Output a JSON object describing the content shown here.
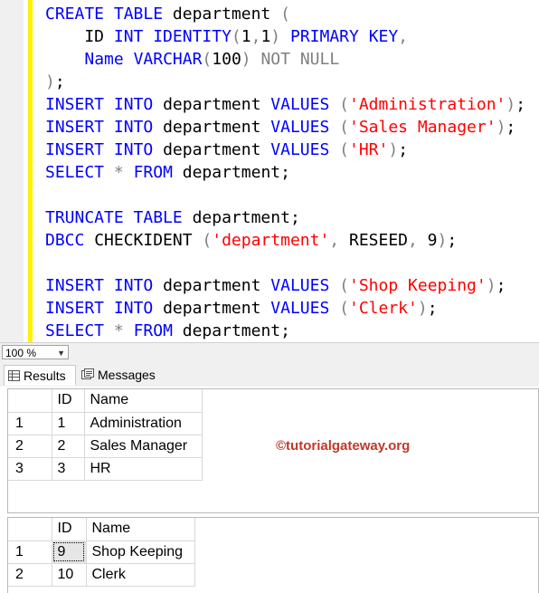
{
  "editor": {
    "lines": [
      [
        {
          "t": "CREATE",
          "c": "kw"
        },
        {
          "t": " ",
          "c": "id"
        },
        {
          "t": "TABLE",
          "c": "kw"
        },
        {
          "t": " department ",
          "c": "id"
        },
        {
          "t": "(",
          "c": "op"
        }
      ],
      [
        {
          "t": "    ID ",
          "c": "id"
        },
        {
          "t": "INT",
          "c": "kw"
        },
        {
          "t": " ",
          "c": "id"
        },
        {
          "t": "IDENTITY",
          "c": "kw"
        },
        {
          "t": "(",
          "c": "op"
        },
        {
          "t": "1",
          "c": "id"
        },
        {
          "t": ",",
          "c": "op"
        },
        {
          "t": "1",
          "c": "id"
        },
        {
          "t": ")",
          "c": "op"
        },
        {
          "t": " ",
          "c": "id"
        },
        {
          "t": "PRIMARY",
          "c": "kw"
        },
        {
          "t": " ",
          "c": "id"
        },
        {
          "t": "KEY",
          "c": "kw"
        },
        {
          "t": ",",
          "c": "op"
        }
      ],
      [
        {
          "t": "    ",
          "c": "id"
        },
        {
          "t": "Name",
          "c": "kw"
        },
        {
          "t": " ",
          "c": "id"
        },
        {
          "t": "VARCHAR",
          "c": "kw"
        },
        {
          "t": "(",
          "c": "op"
        },
        {
          "t": "100",
          "c": "id"
        },
        {
          "t": ")",
          "c": "op"
        },
        {
          "t": " ",
          "c": "id"
        },
        {
          "t": "NOT",
          "c": "op"
        },
        {
          "t": " ",
          "c": "id"
        },
        {
          "t": "NULL",
          "c": "op"
        }
      ],
      [
        {
          "t": ")",
          "c": "op"
        },
        {
          "t": ";",
          "c": "id"
        }
      ],
      [
        {
          "t": "INSERT",
          "c": "kw"
        },
        {
          "t": " ",
          "c": "id"
        },
        {
          "t": "INTO",
          "c": "kw"
        },
        {
          "t": " department ",
          "c": "id"
        },
        {
          "t": "VALUES",
          "c": "kw"
        },
        {
          "t": " ",
          "c": "id"
        },
        {
          "t": "(",
          "c": "op"
        },
        {
          "t": "'Administration'",
          "c": "str"
        },
        {
          "t": ")",
          "c": "op"
        },
        {
          "t": ";",
          "c": "id"
        }
      ],
      [
        {
          "t": "INSERT",
          "c": "kw"
        },
        {
          "t": " ",
          "c": "id"
        },
        {
          "t": "INTO",
          "c": "kw"
        },
        {
          "t": " department ",
          "c": "id"
        },
        {
          "t": "VALUES",
          "c": "kw"
        },
        {
          "t": " ",
          "c": "id"
        },
        {
          "t": "(",
          "c": "op"
        },
        {
          "t": "'Sales Manager'",
          "c": "str"
        },
        {
          "t": ")",
          "c": "op"
        },
        {
          "t": ";",
          "c": "id"
        }
      ],
      [
        {
          "t": "INSERT",
          "c": "kw"
        },
        {
          "t": " ",
          "c": "id"
        },
        {
          "t": "INTO",
          "c": "kw"
        },
        {
          "t": " department ",
          "c": "id"
        },
        {
          "t": "VALUES",
          "c": "kw"
        },
        {
          "t": " ",
          "c": "id"
        },
        {
          "t": "(",
          "c": "op"
        },
        {
          "t": "'HR'",
          "c": "str"
        },
        {
          "t": ")",
          "c": "op"
        },
        {
          "t": ";",
          "c": "id"
        }
      ],
      [
        {
          "t": "SELECT",
          "c": "kw"
        },
        {
          "t": " ",
          "c": "id"
        },
        {
          "t": "*",
          "c": "op"
        },
        {
          "t": " ",
          "c": "id"
        },
        {
          "t": "FROM",
          "c": "kw"
        },
        {
          "t": " department;",
          "c": "id"
        }
      ],
      [
        {
          "t": "",
          "c": "id"
        }
      ],
      [
        {
          "t": "TRUNCATE",
          "c": "kw"
        },
        {
          "t": " ",
          "c": "id"
        },
        {
          "t": "TABLE",
          "c": "kw"
        },
        {
          "t": " department;",
          "c": "id"
        }
      ],
      [
        {
          "t": "DBCC",
          "c": "kw"
        },
        {
          "t": " CHECKIDENT ",
          "c": "id"
        },
        {
          "t": "(",
          "c": "op"
        },
        {
          "t": "'department'",
          "c": "str"
        },
        {
          "t": ",",
          "c": "op"
        },
        {
          "t": " RESEED",
          "c": "id"
        },
        {
          "t": ",",
          "c": "op"
        },
        {
          "t": " 9",
          "c": "id"
        },
        {
          "t": ")",
          "c": "op"
        },
        {
          "t": ";",
          "c": "id"
        }
      ],
      [
        {
          "t": "",
          "c": "id"
        }
      ],
      [
        {
          "t": "INSERT",
          "c": "kw"
        },
        {
          "t": " ",
          "c": "id"
        },
        {
          "t": "INTO",
          "c": "kw"
        },
        {
          "t": " department ",
          "c": "id"
        },
        {
          "t": "VALUES",
          "c": "kw"
        },
        {
          "t": " ",
          "c": "id"
        },
        {
          "t": "(",
          "c": "op"
        },
        {
          "t": "'Shop Keeping'",
          "c": "str"
        },
        {
          "t": ")",
          "c": "op"
        },
        {
          "t": ";",
          "c": "id"
        }
      ],
      [
        {
          "t": "INSERT",
          "c": "kw"
        },
        {
          "t": " ",
          "c": "id"
        },
        {
          "t": "INTO",
          "c": "kw"
        },
        {
          "t": " department ",
          "c": "id"
        },
        {
          "t": "VALUES",
          "c": "kw"
        },
        {
          "t": " ",
          "c": "id"
        },
        {
          "t": "(",
          "c": "op"
        },
        {
          "t": "'Clerk'",
          "c": "str"
        },
        {
          "t": ")",
          "c": "op"
        },
        {
          "t": ";",
          "c": "id"
        }
      ],
      [
        {
          "t": "SELECT",
          "c": "kw"
        },
        {
          "t": " ",
          "c": "id"
        },
        {
          "t": "*",
          "c": "op"
        },
        {
          "t": " ",
          "c": "id"
        },
        {
          "t": "FROM",
          "c": "kw"
        },
        {
          "t": " department;",
          "c": "id"
        }
      ]
    ]
  },
  "zoom": {
    "value": "100 %"
  },
  "tabs": {
    "results_label": "Results",
    "messages_label": "Messages"
  },
  "result1": {
    "columns": [
      "ID",
      "Name"
    ],
    "rows": [
      {
        "num": "1",
        "id": "1",
        "name": "Administration"
      },
      {
        "num": "2",
        "id": "2",
        "name": "Sales Manager"
      },
      {
        "num": "3",
        "id": "3",
        "name": "HR"
      }
    ]
  },
  "result2": {
    "columns": [
      "ID",
      "Name"
    ],
    "rows": [
      {
        "num": "1",
        "id": "9",
        "name": "Shop Keeping"
      },
      {
        "num": "2",
        "id": "10",
        "name": "Clerk"
      }
    ]
  },
  "watermark": "©tutorialgateway.org",
  "colors": {
    "keyword": "#0000ff",
    "string": "#ff0000",
    "operator": "#808080",
    "change_bar": "#fff200"
  }
}
